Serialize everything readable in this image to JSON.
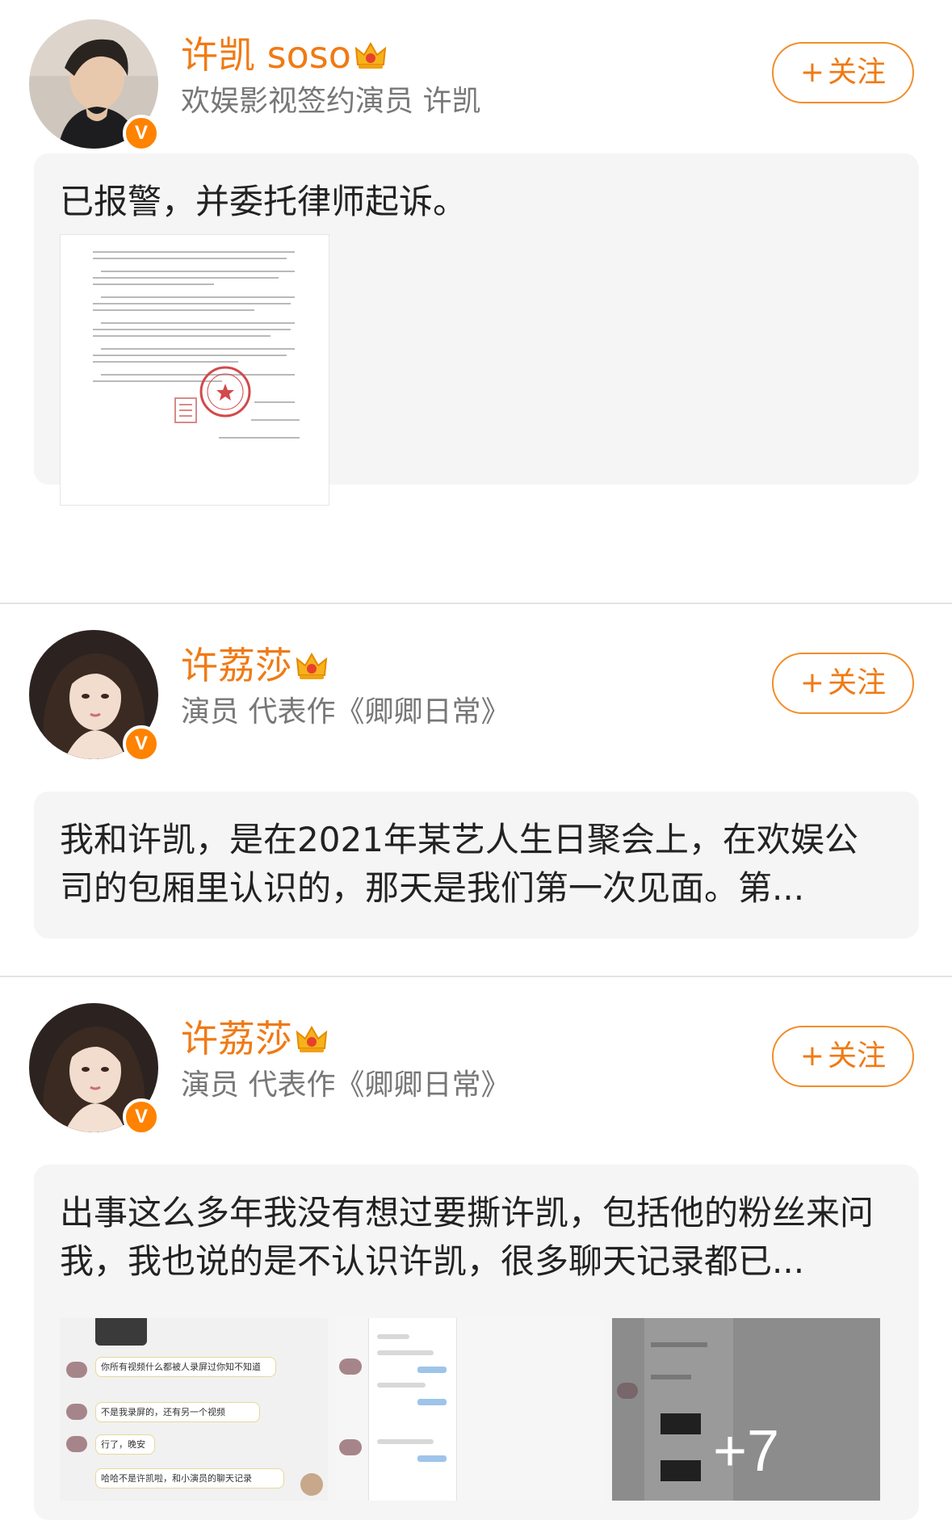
{
  "posts": [
    {
      "username": "许凯 soso",
      "bio": "欢娱影视签约演员 许凯",
      "follow_label": "关注",
      "follow_plus": "+",
      "verified_badge": "V",
      "content": "已报警，并委托律师起诉。",
      "attachment": "legal-statement-document",
      "avatar_icon": "male-avatar-icon"
    },
    {
      "username": "许荔莎",
      "bio": "演员 代表作《卿卿日常》",
      "follow_label": "关注",
      "follow_plus": "+",
      "verified_badge": "V",
      "content": "我和许凯，是在2021年某艺人生日聚会上，在欢娱公司的包厢里认识的，那天是我们第一次见面。第...",
      "avatar_icon": "female-avatar-icon"
    },
    {
      "username": "许荔莎",
      "bio": "演员 代表作《卿卿日常》",
      "follow_label": "关注",
      "follow_plus": "+",
      "verified_badge": "V",
      "content": "出事这么多年我没有想过要撕许凯，包括他的粉丝来问我，我也说的是不认识许凯，很多聊天记录都已...",
      "more_images_label": "+7",
      "avatar_icon": "female-avatar-icon"
    }
  ],
  "chat_thumb_1": {
    "messages": [
      "你所有视频什么都被人录屏过你知不知道",
      "不是我录屏的，还有另一个视频",
      "行了，晚安",
      "哈哈不是许凯啦，和小演员的聊天记录"
    ]
  },
  "colors": {
    "brand_orange": "#ff8200",
    "username_orange": "#f07a14",
    "card_bg": "#f5f5f5",
    "divider": "#e3e3e3"
  }
}
